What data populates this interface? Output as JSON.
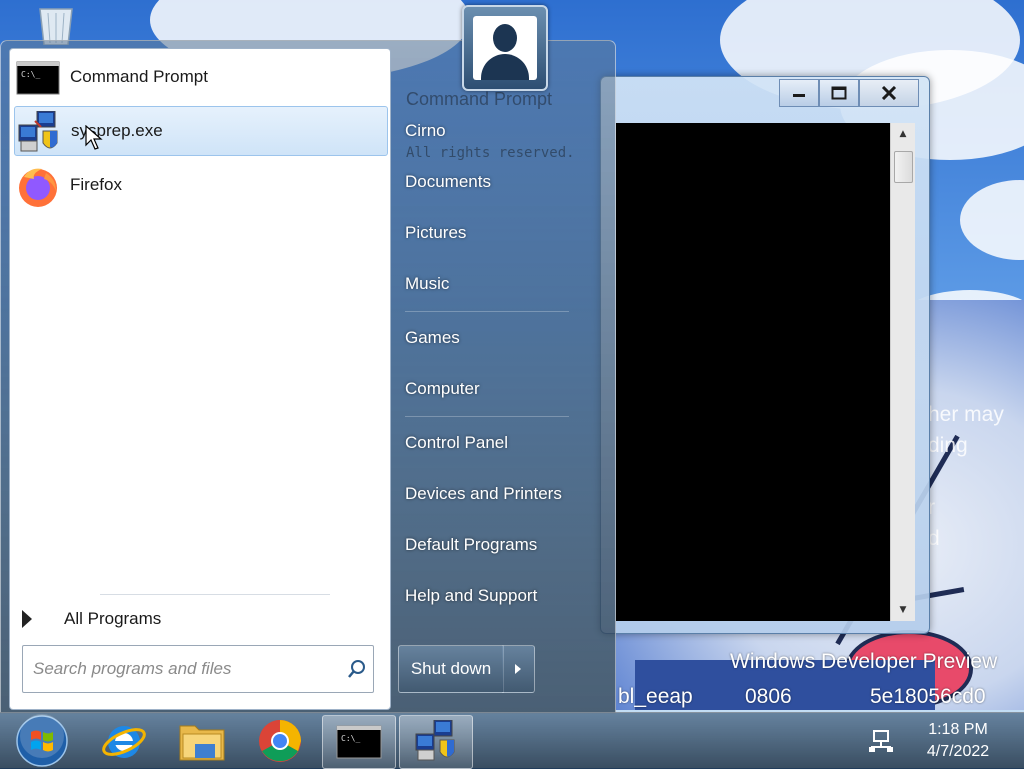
{
  "desktop": {
    "watermark_title": "Windows Developer Preview",
    "watermark_build_frag": "bl_eeap",
    "watermark_build_frag2": "0806",
    "watermark_build_frag3": "5e18056cd0",
    "balloon_frags": [
      "her may",
      "ding",
      "r",
      "d"
    ]
  },
  "background_window": {
    "title": "Command Prompt",
    "body_text": "All rights reserved."
  },
  "start_menu": {
    "programs": [
      {
        "label": "Command Prompt",
        "icon": "cmd-icon"
      },
      {
        "label": "sysprep.exe",
        "icon": "sysprep-icon"
      },
      {
        "label": "Firefox",
        "icon": "firefox-icon"
      }
    ],
    "all_programs": "All Programs",
    "search_placeholder": "Search programs and files",
    "right_items": [
      "Cirno",
      "Documents",
      "Pictures",
      "Music",
      "Games",
      "Computer",
      "Control Panel",
      "Devices and Printers",
      "Default Programs",
      "Help and Support"
    ],
    "shutdown_label": "Shut down"
  },
  "taskbar": {
    "items": [
      "start-orb",
      "internet-explorer-icon",
      "file-explorer-icon",
      "chrome-icon",
      "cmd-icon",
      "sysprep-icon"
    ],
    "time": "1:18 PM",
    "date": "4/7/2022"
  },
  "colors": {
    "menu_highlight": "#cfe4f8",
    "taskbar": "#2a4560"
  }
}
